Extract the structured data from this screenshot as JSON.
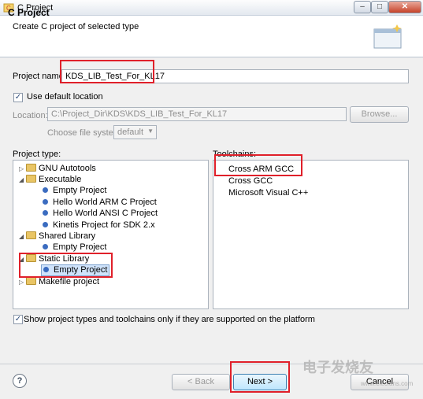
{
  "window": {
    "title": "C Project"
  },
  "header": {
    "title": "C Project",
    "description": "Create C project of selected type"
  },
  "project_name": {
    "label": "Project name:",
    "value": "KDS_LIB_Test_For_KL17"
  },
  "default_location": {
    "label": "Use default location",
    "checked": true
  },
  "location": {
    "label": "Location:",
    "value": "C:\\Project_Dir\\KDS\\KDS_LIB_Test_For_KL17",
    "browse_label": "Browse..."
  },
  "file_system": {
    "label": "Choose file system:",
    "value": "default"
  },
  "project_type": {
    "label": "Project type:",
    "items": [
      {
        "label": "GNU Autotools"
      },
      {
        "label": "Executable"
      },
      {
        "label": "Empty Project"
      },
      {
        "label": "Hello World ARM C Project"
      },
      {
        "label": "Hello World ANSI C Project"
      },
      {
        "label": "Kinetis Project for SDK 2.x"
      },
      {
        "label": "Shared Library"
      },
      {
        "label": "Empty Project"
      },
      {
        "label": "Static Library"
      },
      {
        "label": "Empty Project"
      },
      {
        "label": "Makefile project"
      }
    ]
  },
  "toolchains": {
    "label": "Toolchains:",
    "items": [
      {
        "label": "Cross ARM GCC"
      },
      {
        "label": "Cross GCC"
      },
      {
        "label": "Microsoft Visual C++"
      }
    ]
  },
  "filter": {
    "label": "Show project types and toolchains only if they are supported on the platform",
    "checked": true
  },
  "footer": {
    "back_label": "< Back",
    "next_label": "Next >",
    "cancel_label": "Cancel"
  },
  "watermark": {
    "text": "电子发烧友",
    "url": "www.elecfans.com"
  },
  "colors": {
    "highlight_red": "#e0202a",
    "selection_blue": "#cfe3fb",
    "bullet_blue": "#3b6cc0",
    "folder_yellow": "#e9c565"
  },
  "icons": {
    "app": "c-project-icon",
    "wizard": "wizard-banner-icon",
    "help": "help-icon"
  }
}
